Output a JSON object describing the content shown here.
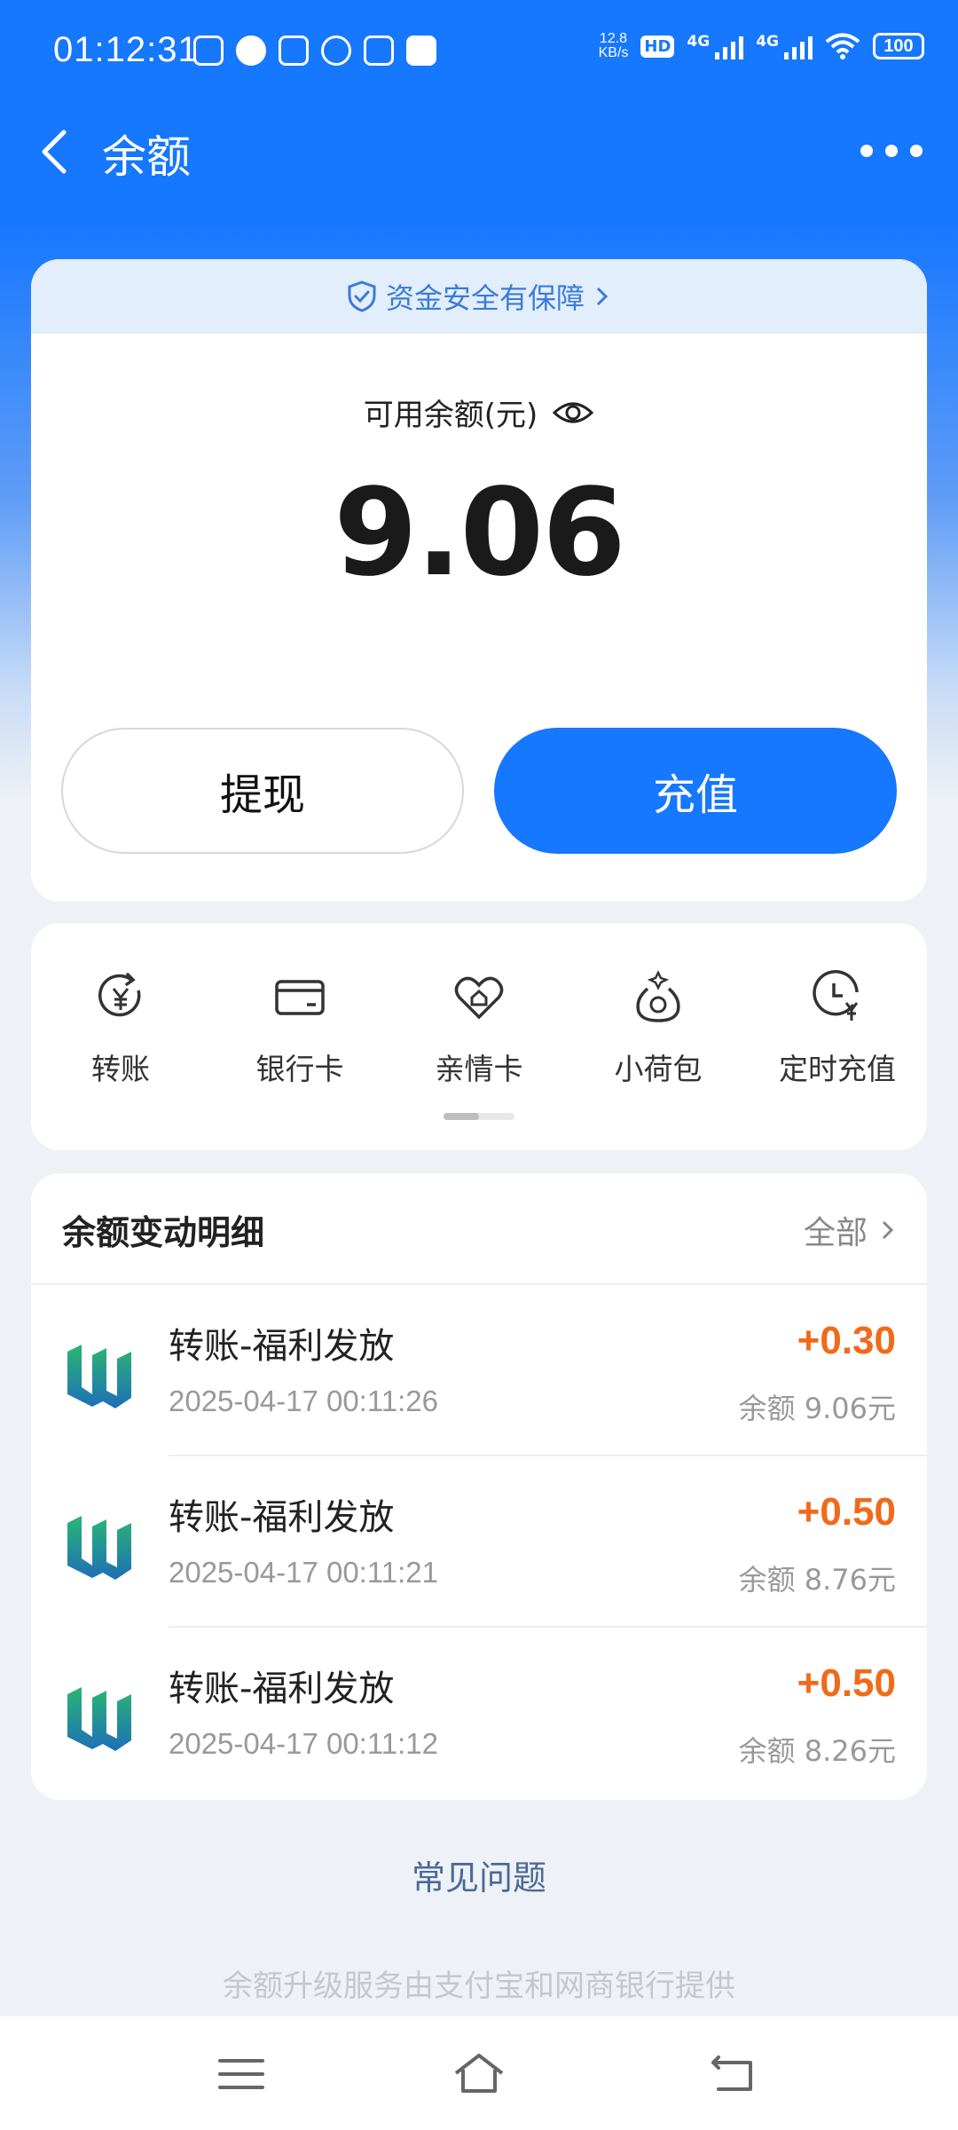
{
  "status_bar": {
    "time": "01:12:31",
    "net_speed_value": "12.8",
    "net_speed_unit": "KB/s",
    "hd_label": "HD",
    "signal1_label": "4G",
    "signal2_label": "4G",
    "battery": "100"
  },
  "header": {
    "title": "余额"
  },
  "balance_card": {
    "security_text": "资金安全有保障",
    "label": "可用余额(元)",
    "amount": "9.06",
    "withdraw_label": "提现",
    "recharge_label": "充值"
  },
  "actions": [
    {
      "label": "转账",
      "icon": "transfer-yen-icon"
    },
    {
      "label": "银行卡",
      "icon": "bank-card-icon"
    },
    {
      "label": "亲情卡",
      "icon": "family-card-heart-icon"
    },
    {
      "label": "小荷包",
      "icon": "pouch-icon"
    },
    {
      "label": "定时充值",
      "icon": "scheduled-recharge-icon"
    }
  ],
  "details": {
    "title": "余额变动明细",
    "all_label": "全部",
    "transactions": [
      {
        "title": "转账-福利发放",
        "time": "2025-04-17 00:11:26",
        "amount": "+0.30",
        "balance": "余额 9.06元"
      },
      {
        "title": "转账-福利发放",
        "time": "2025-04-17 00:11:21",
        "amount": "+0.50",
        "balance": "余额 8.76元"
      },
      {
        "title": "转账-福利发放",
        "time": "2025-04-17 00:11:12",
        "amount": "+0.50",
        "balance": "余额 8.26元"
      }
    ]
  },
  "faq_label": "常见问题",
  "footer_note": "余额升级服务由支付宝和网商银行提供",
  "colors": {
    "brand": "#1677ff",
    "amount_positive": "#f06a1a"
  }
}
